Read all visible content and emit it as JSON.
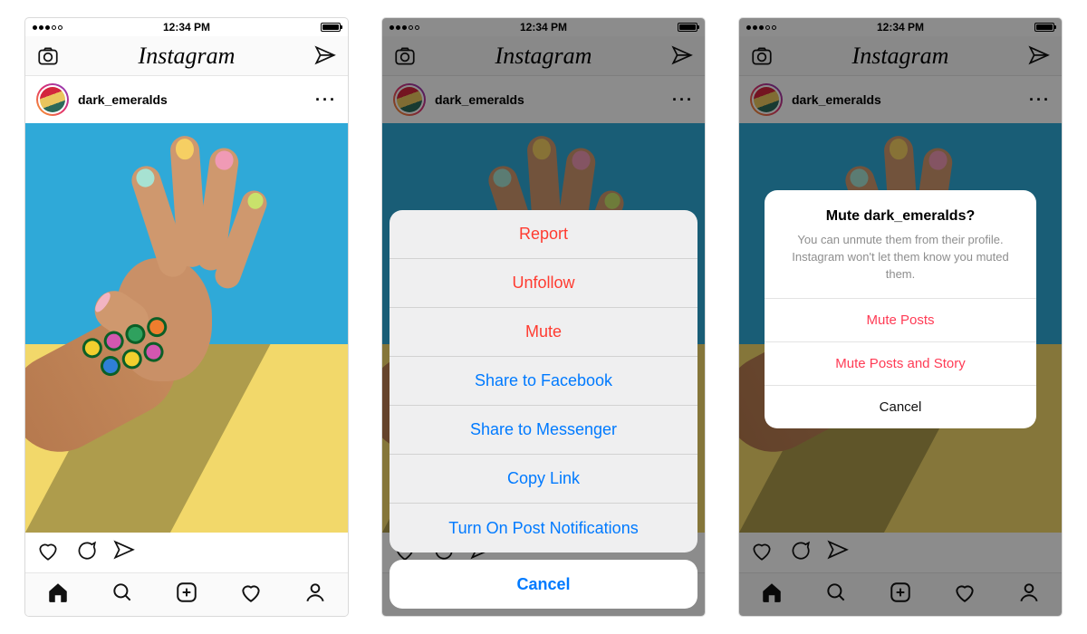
{
  "status_bar": {
    "time": "12:34 PM"
  },
  "topnav": {
    "logo": "Instagram"
  },
  "post": {
    "username": "dark_emeralds"
  },
  "action_sheet": {
    "items": [
      {
        "label": "Report",
        "style": "red"
      },
      {
        "label": "Unfollow",
        "style": "red"
      },
      {
        "label": "Mute",
        "style": "red"
      },
      {
        "label": "Share to Facebook",
        "style": "blue"
      },
      {
        "label": "Share to Messenger",
        "style": "blue"
      },
      {
        "label": "Copy Link",
        "style": "blue"
      },
      {
        "label": "Turn On Post Notifications",
        "style": "blue"
      }
    ],
    "cancel": "Cancel"
  },
  "mute_alert": {
    "title": "Mute dark_emeralds?",
    "body": "You can unmute them from their profile. Instagram won't let them know you muted them.",
    "option_posts": "Mute Posts",
    "option_posts_story": "Mute Posts and Story",
    "cancel": "Cancel"
  }
}
